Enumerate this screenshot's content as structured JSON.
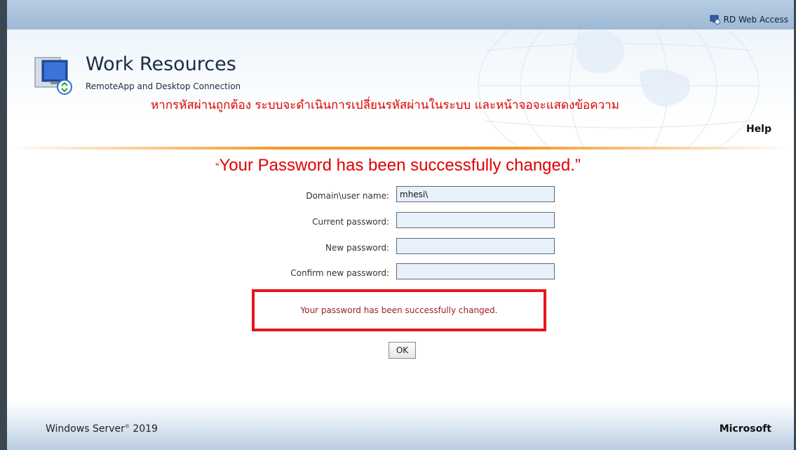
{
  "topbar": {
    "label": "RD Web Access"
  },
  "header": {
    "title": "Work Resources",
    "subtitle": "RemoteApp and Desktop Connection",
    "help": "Help"
  },
  "annotation": {
    "thai": "หากรหัสผ่านถูกต้อง ระบบจะดำเนินการเปลี่ยนรหัสผ่านในระบบ และหน้าจอจะแสดงข้อความ",
    "quote_open": "“",
    "english": "Your Password has been successfully changed.”"
  },
  "form": {
    "domain_label": "Domain\\user name:",
    "domain_value": "mhesi\\",
    "current_label": "Current password:",
    "new_label": "New password:",
    "confirm_label": "Confirm new password:"
  },
  "message": "Your password has been successfully changed.",
  "ok_label": "OK",
  "footer": {
    "left": "Windows Server",
    "left_mark": "®",
    "left_year": "2019",
    "right": "Microsoft"
  },
  "colors": {
    "annotation": "#e00000",
    "highlight_box": "#e8141c",
    "accent_line": "#f59628"
  }
}
